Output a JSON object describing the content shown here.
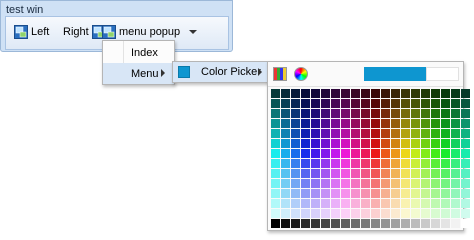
{
  "window": {
    "title": "test win"
  },
  "toolbar": {
    "left_label": "Left",
    "right_label": "Right",
    "menu_label": "menu popup"
  },
  "menu1": {
    "items": [
      {
        "label": "Index"
      },
      {
        "label": "Menu"
      }
    ]
  },
  "menu2": {
    "items": [
      {
        "label": "Color Picker",
        "swatch": "#0e96d0"
      }
    ]
  },
  "picker": {
    "selected_color": "#0e96d0",
    "grid_view_icon": "palette-grid-icon",
    "wheel_view_icon": "color-wheel-icon"
  }
}
